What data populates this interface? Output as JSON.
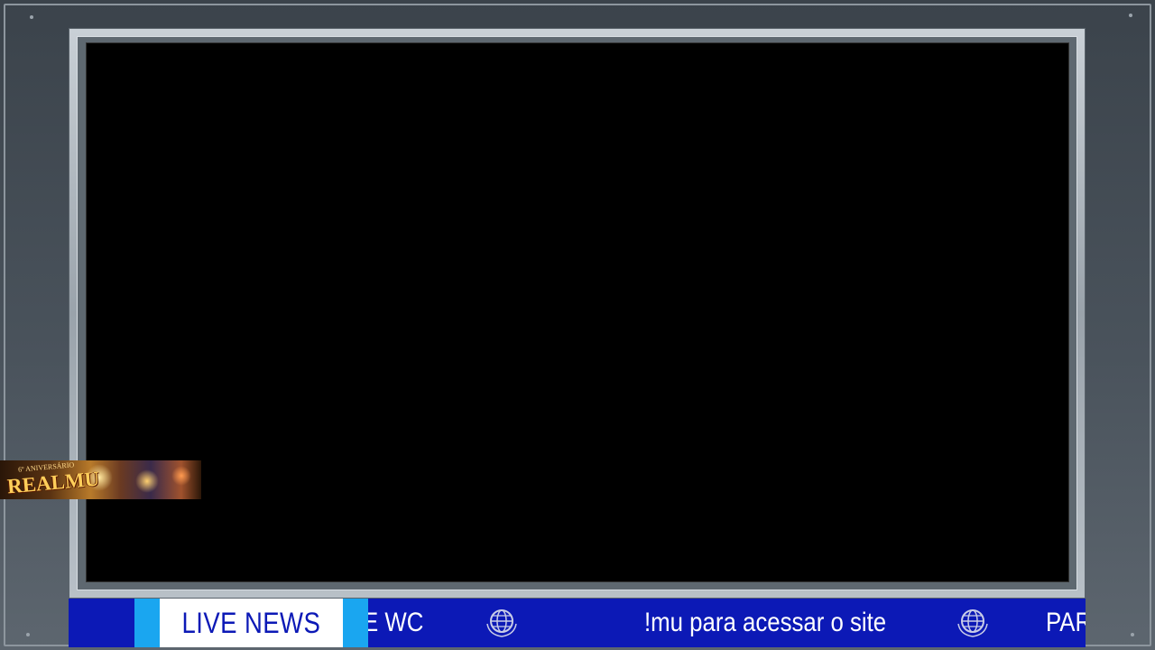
{
  "ticker": {
    "live_label": "LIVE NEWS",
    "items": [
      "E WC",
      "!mu para acessar o site",
      "PARTY JE"
    ],
    "separator_icon": "globe-emblem-icon",
    "colors": {
      "bar": "#0c19b6",
      "accent": "#1aa6f0",
      "label_bg": "#ffffff",
      "text": "#ffffff"
    }
  },
  "promo_banner": {
    "subtitle": "6º ANIVERSÁRIO",
    "title": "REALMU"
  },
  "screen": {
    "color": "#000000"
  },
  "frame": {
    "color": "#4a535c"
  }
}
